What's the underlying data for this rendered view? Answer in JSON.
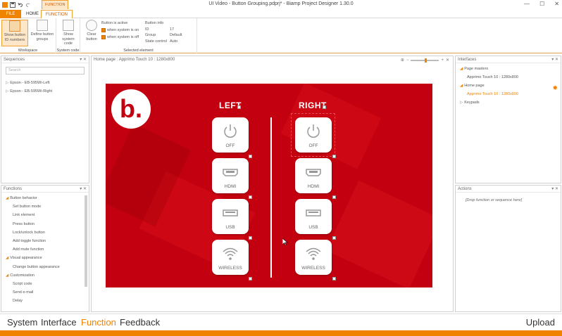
{
  "window": {
    "title": "UI Video - Button Grouping.pdprj* - Biamp Project Designer 1.30.0",
    "context_tab": "FUNCTION",
    "controls": [
      "—",
      "☐",
      "✕"
    ]
  },
  "tabs": {
    "file": "FILE",
    "home": "HOME",
    "function": "FUNCTION"
  },
  "ribbon": {
    "workspace": {
      "label": "Workspace",
      "show_ids": "Show button ID numbers",
      "define_groups": "Define button groups"
    },
    "system_code": {
      "label": "System code",
      "show_code": "Show system code"
    },
    "selected_element": {
      "label": "Selected element",
      "clear_button": "Clear button",
      "button_is_active": "Button is active",
      "when_on": "when system is on",
      "when_off": "when system is off",
      "info_title": "Button info",
      "info": [
        {
          "k": "ID",
          "v": "17"
        },
        {
          "k": "Group",
          "v": "Default"
        },
        {
          "k": "State control",
          "v": "Auto"
        }
      ]
    }
  },
  "sequences": {
    "title": "Sequences",
    "search_placeholder": "Search",
    "items": [
      "Epson - EB-595Wi-Left",
      "Epson - EB-595Wi-Right"
    ]
  },
  "functions": {
    "title": "Functions",
    "groups": [
      {
        "label": "Button behavior",
        "items": [
          "Set button mode",
          "Link element",
          "Press button",
          "Lock/unlock button",
          "Add toggle function",
          "Add mute function"
        ]
      },
      {
        "label": "Visual appearance",
        "items": [
          "Change button appearance"
        ]
      },
      {
        "label": "Customization",
        "items": [
          "Script code",
          "Send e-mail",
          "Delay"
        ]
      }
    ]
  },
  "canvas": {
    "breadcrumb": "Home page : Apprimo Touch 10 : 1280x800",
    "left_title": "LEFT",
    "right_title": "RIGHT",
    "logo_text": "b.",
    "buttons": [
      "OFF",
      "HDMI",
      "USB",
      "WIRELESS"
    ]
  },
  "interfaces": {
    "title": "Interfaces",
    "page_masters": "Page masters",
    "page_masters_item": "Apprimo Touch 10 : 1280x800",
    "home_page": "Home page",
    "home_page_item": "Apprimo Touch 10 : 1280x800",
    "keypads": "Keypads"
  },
  "actions": {
    "title": "Actions",
    "placeholder": "[Drop function or sequence here]"
  },
  "bottom_nav": {
    "system": "System",
    "interface": "Interface",
    "function": "Function",
    "feedback": "Feedback",
    "upload": "Upload"
  },
  "colors": {
    "accent": "#f08300",
    "stage_red": "#c3000f"
  }
}
